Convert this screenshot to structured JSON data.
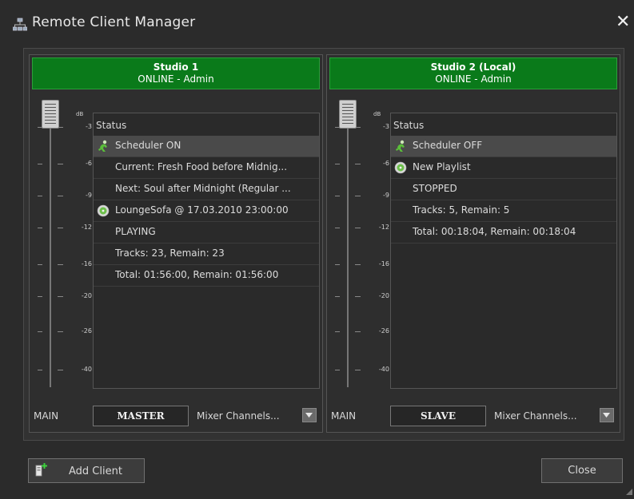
{
  "window": {
    "title": "Remote Client Manager",
    "close_glyph": "✕"
  },
  "studios": [
    {
      "name": "Studio 1",
      "status": "ONLINE - Admin",
      "header_color": "#0a7a1a",
      "fader": {
        "unit": "dB",
        "scale": [
          "-3",
          "-6",
          "-9",
          "-12",
          "-16",
          "-20",
          "-26",
          "-40"
        ],
        "level": 1.0
      },
      "list_header": "Status",
      "items": [
        {
          "icon": "scheduler-icon",
          "text": "Scheduler ON",
          "selected": true
        },
        {
          "icon": "",
          "text": "Current: Fresh Food before Midnig..."
        },
        {
          "icon": "",
          "text": "Next: Soul after Midnight (Regular ..."
        },
        {
          "icon": "playlist-icon",
          "text": "LoungeSofa @ 17.03.2010 23:00:00"
        },
        {
          "icon": "",
          "text": "PLAYING"
        },
        {
          "icon": "",
          "text": "Tracks: 23, Remain: 23"
        },
        {
          "icon": "",
          "text": "Total: 01:56:00, Remain: 01:56:00"
        }
      ],
      "bottom": {
        "main_label": "MAIN",
        "role": "MASTER",
        "mixer_label": "Mixer Channels..."
      }
    },
    {
      "name": "Studio 2 (Local)",
      "status": "ONLINE - Admin",
      "header_color": "#0a7a1a",
      "fader": {
        "unit": "dB",
        "scale": [
          "-3",
          "-6",
          "-9",
          "-12",
          "-16",
          "-20",
          "-26",
          "-40"
        ],
        "level": 1.0
      },
      "list_header": "Status",
      "items": [
        {
          "icon": "scheduler-icon",
          "text": "Scheduler OFF",
          "selected": true
        },
        {
          "icon": "playlist-icon",
          "text": "New Playlist"
        },
        {
          "icon": "",
          "text": "STOPPED"
        },
        {
          "icon": "",
          "text": "Tracks: 5, Remain: 5"
        },
        {
          "icon": "",
          "text": "Total: 00:18:04, Remain: 00:18:04"
        }
      ],
      "bottom": {
        "main_label": "MAIN",
        "role": "SLAVE",
        "mixer_label": "Mixer Channels..."
      }
    }
  ],
  "footer": {
    "add_client_label": "Add Client",
    "close_label": "Close"
  }
}
